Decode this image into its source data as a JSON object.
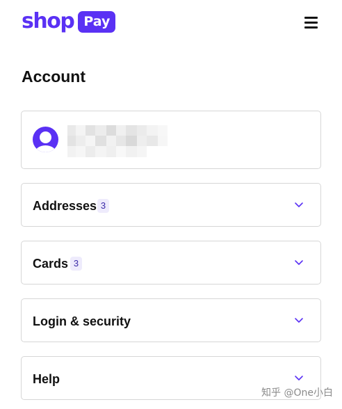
{
  "header": {
    "logo_text": "shop",
    "logo_badge": "Pay",
    "brand_color": "#5a31f4",
    "menu_icon": "hamburger-menu-icon"
  },
  "page": {
    "title": "Account"
  },
  "profile": {
    "avatar_icon": "user-avatar-icon",
    "name_redacted": true
  },
  "sections": [
    {
      "label": "Addresses",
      "count": "3",
      "icon": "chevron-down-icon"
    },
    {
      "label": "Cards",
      "count": "3",
      "icon": "chevron-down-icon"
    },
    {
      "label": "Login & security",
      "icon": "chevron-down-icon"
    },
    {
      "label": "Help",
      "icon": "chevron-down-icon"
    }
  ],
  "watermark": {
    "text": "知乎 @One小白"
  }
}
